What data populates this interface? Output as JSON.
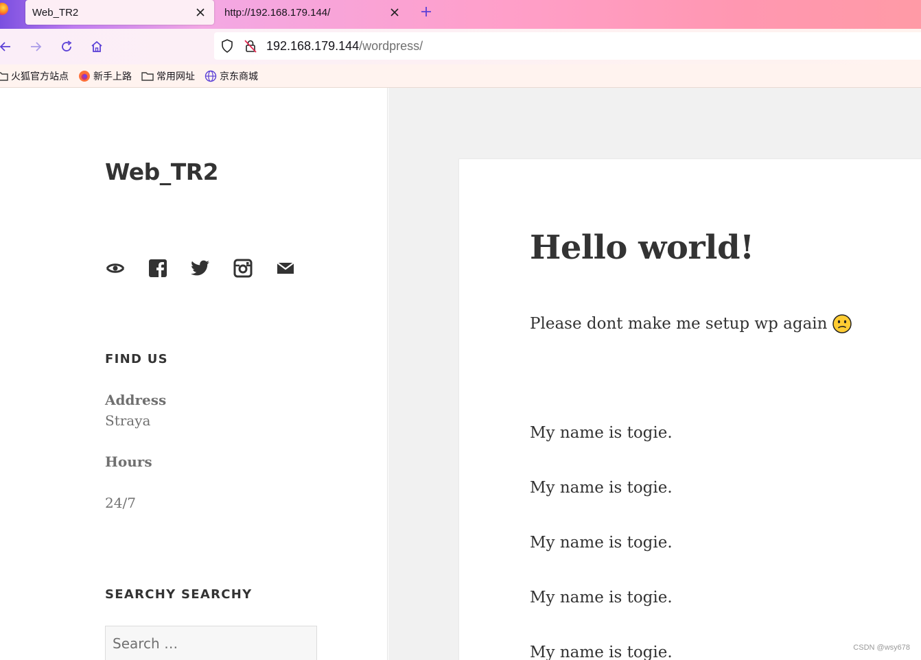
{
  "browser": {
    "tabs": [
      {
        "title": "Web_TR2",
        "active": true
      },
      {
        "title": "http://192.168.179.144/",
        "active": false
      }
    ],
    "url": {
      "host": "192.168.179.144",
      "path": "/wordpress/"
    },
    "bookmarks": [
      {
        "label": "火狐官方站点",
        "icon": "folder-icon"
      },
      {
        "label": "新手上路",
        "icon": "firefox-icon"
      },
      {
        "label": "常用网址",
        "icon": "folder-icon"
      },
      {
        "label": "京东商城",
        "icon": "globe-icon"
      }
    ],
    "accent_color": "#5a3fd6"
  },
  "sidebar": {
    "site_title": "Web_TR2",
    "social_icons": [
      "yelp-icon",
      "facebook-icon",
      "twitter-icon",
      "instagram-icon",
      "email-icon"
    ],
    "find_us": {
      "heading": "FIND US",
      "address_label": "Address",
      "address_value": "Straya",
      "hours_label": "Hours",
      "hours_value": "24/7"
    },
    "search_widget": {
      "heading": "SEARCHY SEARCHY",
      "placeholder": "Search …"
    }
  },
  "post": {
    "title": "Hello world!",
    "intro": "Please dont make me setup wp again",
    "emoji": "confused-face",
    "paragraphs": [
      "My name is togie.",
      "My name is togie.",
      "My name is togie.",
      "My name is togie.",
      "My name is togie."
    ]
  },
  "watermark": "CSDN @wsy678"
}
